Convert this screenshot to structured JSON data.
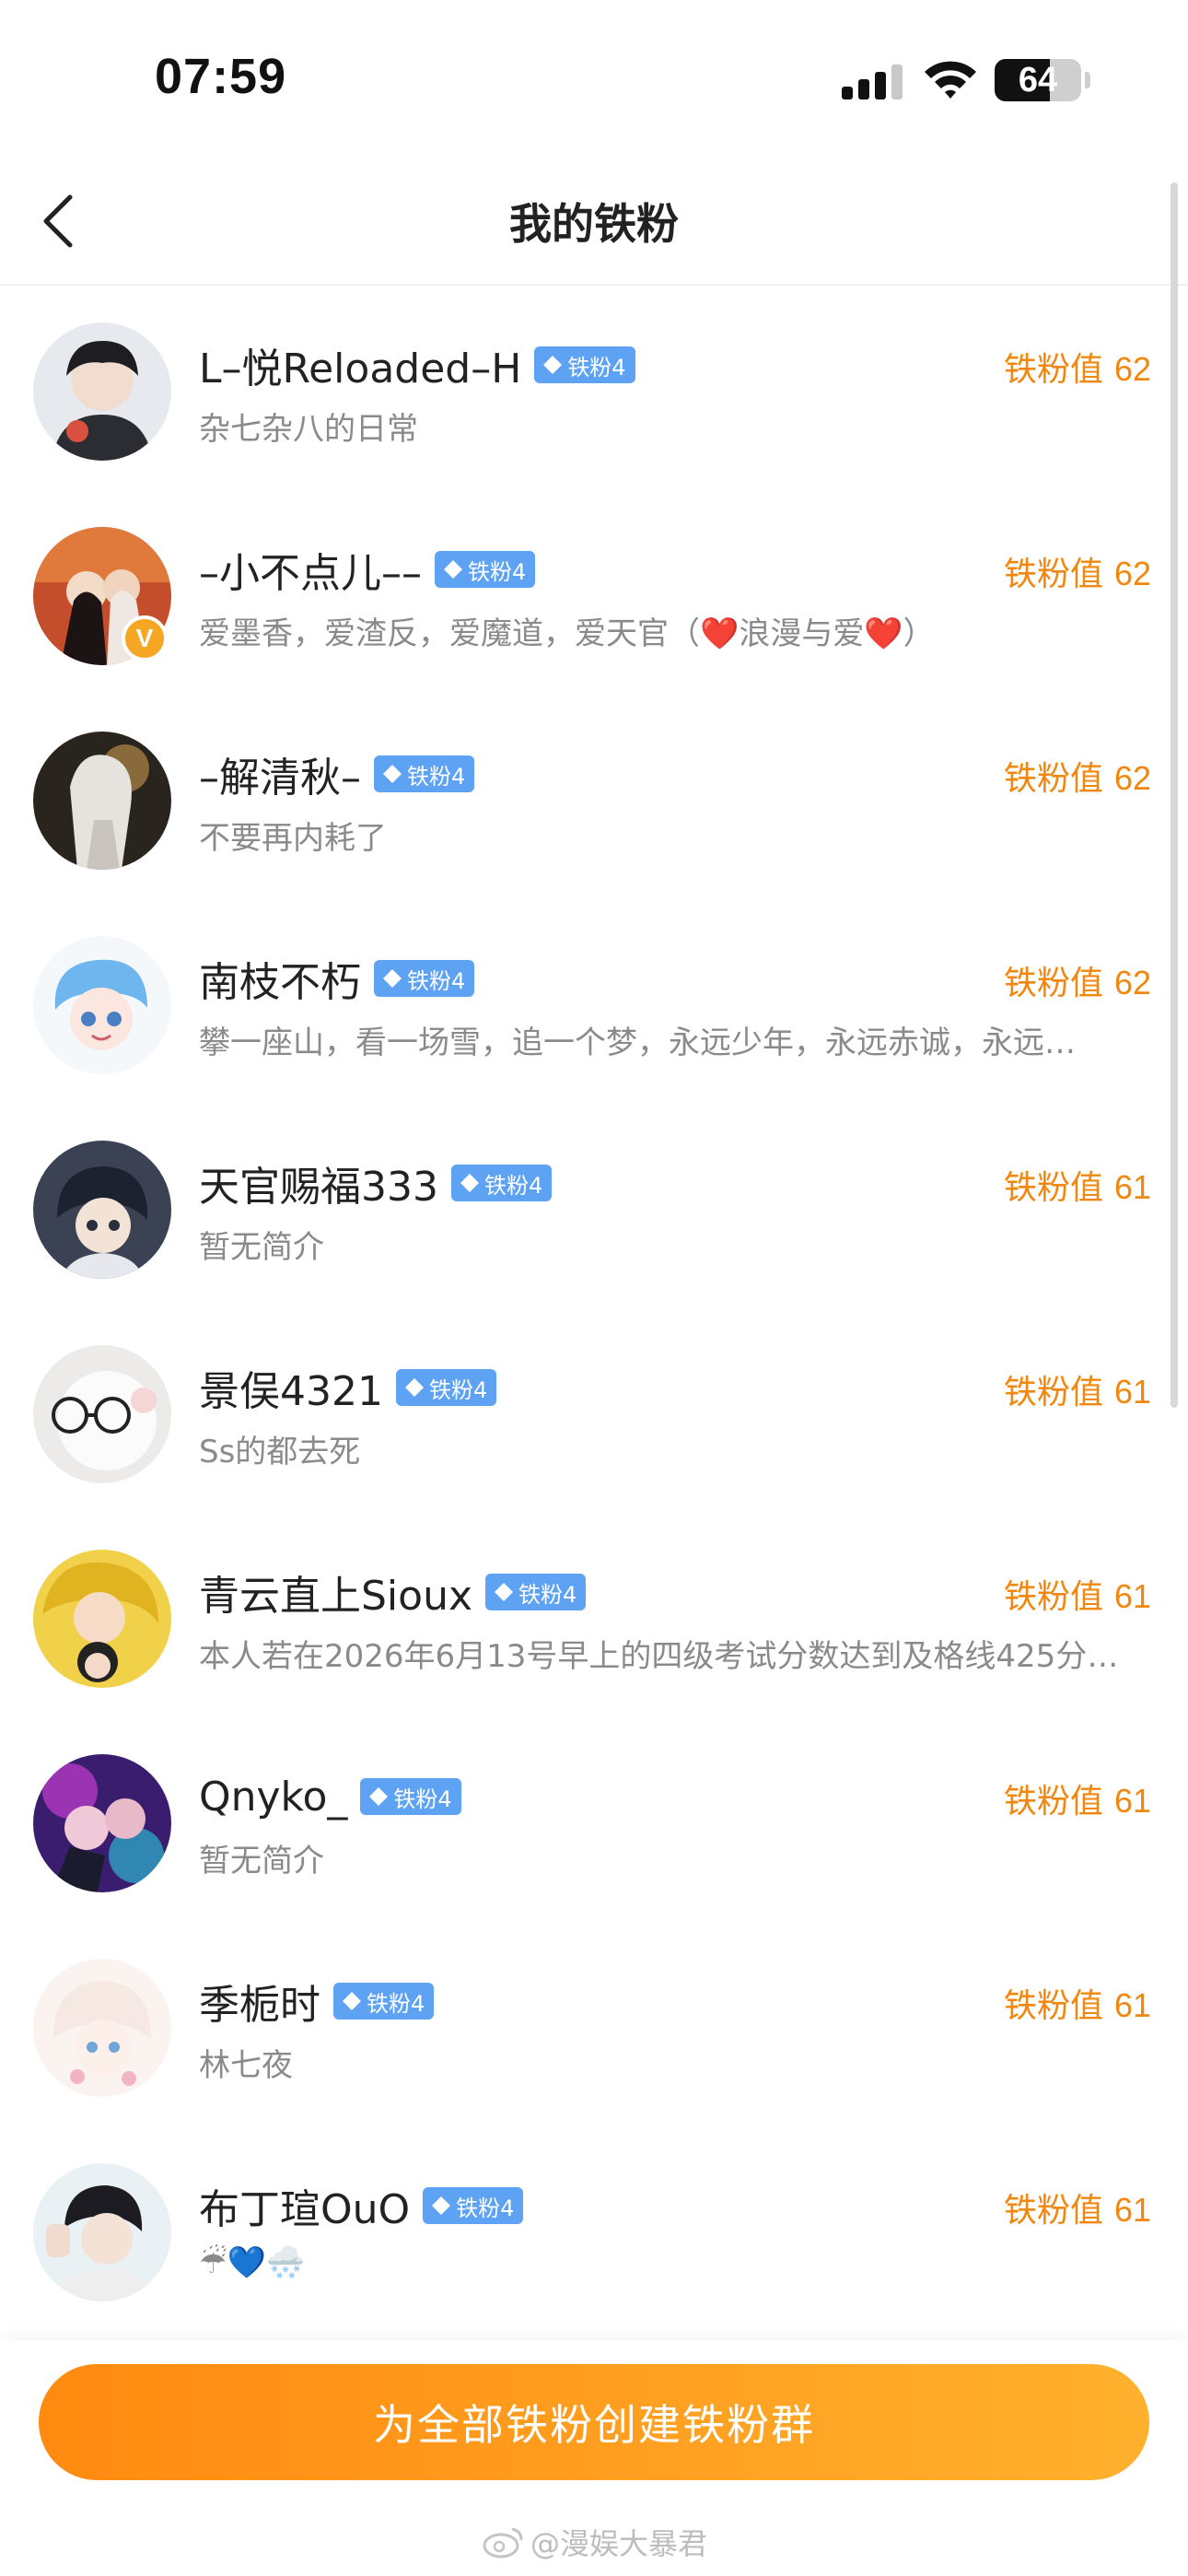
{
  "status_bar": {
    "time": "07:59",
    "battery": "64",
    "battery_level": 0.64
  },
  "header": {
    "title": "我的铁粉"
  },
  "fans": [
    {
      "name": "L–悦Reloaded–H",
      "badge": "铁粉4",
      "bio": "杂七杂八的日常",
      "score_label": "铁粉值",
      "score": "62"
    },
    {
      "name": "–小不点儿––",
      "badge": "铁粉4",
      "bio": "爱墨香，爱渣反，爱魔道，爱天官（❤️浪漫与爱❤️）",
      "score_label": "铁粉值",
      "score": "62",
      "verified": true
    },
    {
      "name": "–解清秋–",
      "badge": "铁粉4",
      "bio": "不要再内耗了",
      "score_label": "铁粉值",
      "score": "62"
    },
    {
      "name": "南枝不朽",
      "badge": "铁粉4",
      "bio": "攀一座山，看一场雪，追一个梦，永远少年，永远赤诚，永远…",
      "score_label": "铁粉值",
      "score": "62"
    },
    {
      "name": "天官赐福333",
      "badge": "铁粉4",
      "bio": "暂无简介",
      "score_label": "铁粉值",
      "score": "61"
    },
    {
      "name": "景俣4321",
      "badge": "铁粉4",
      "bio": "Ss的都去死",
      "score_label": "铁粉值",
      "score": "61"
    },
    {
      "name": "青云直上Sioux",
      "badge": "铁粉4",
      "bio": "本人若在2026年6月13号早上的四级考试分数达到及格线425分…",
      "score_label": "铁粉值",
      "score": "61"
    },
    {
      "name": "Qnyko_",
      "badge": "铁粉4",
      "bio": "暂无简介",
      "score_label": "铁粉值",
      "score": "61"
    },
    {
      "name": "季栀时",
      "badge": "铁粉4",
      "bio": "林七夜",
      "score_label": "铁粉值",
      "score": "61"
    },
    {
      "name": "布丁瑄OuO",
      "badge": "铁粉4",
      "bio": "☔💙🌨️",
      "score_label": "铁粉值",
      "score": "61"
    }
  ],
  "bottom": {
    "button_label": "为全部铁粉创建铁粉群",
    "watermark": "@漫娱大暴君"
  },
  "colors": {
    "accent": "#f2870f",
    "badge": "#5ea2f4",
    "button_start": "#ff8a10",
    "button_end": "#ffb12e"
  }
}
